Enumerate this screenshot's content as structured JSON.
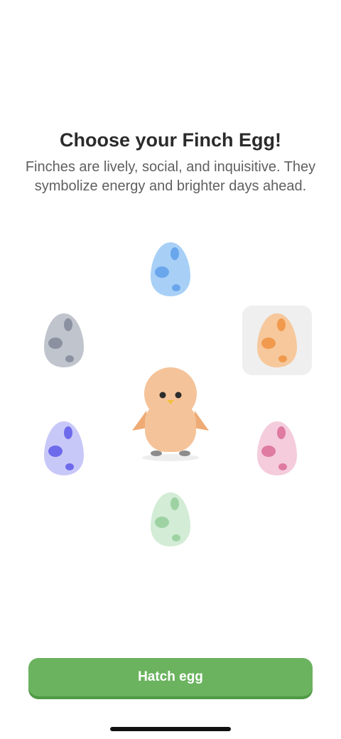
{
  "header": {
    "title": "Choose your Finch Egg!",
    "subtitle": "Finches are lively, social, and inquisitive. They symbolize energy and brighter days ahead."
  },
  "eggs": [
    {
      "name": "blue-egg",
      "color": "#a8d0f7",
      "spot": "#6aa6ec",
      "selected": false
    },
    {
      "name": "gray-egg",
      "color": "#c0c4cd",
      "spot": "#8b91a0",
      "selected": false
    },
    {
      "name": "orange-egg",
      "color": "#f6c89c",
      "spot": "#f19a4e",
      "selected": true
    },
    {
      "name": "purple-egg",
      "color": "#c8c8f8",
      "spot": "#6e6aec",
      "selected": false
    },
    {
      "name": "pink-egg",
      "color": "#f4ccdc",
      "spot": "#df7aa0",
      "selected": false
    },
    {
      "name": "green-egg",
      "color": "#d3ecd6",
      "spot": "#9ed2a3",
      "selected": false
    }
  ],
  "finch": {
    "body_color": "#f5c39a",
    "wing_color": "#efab74"
  },
  "actions": {
    "hatch_label": "Hatch egg"
  },
  "colors": {
    "accent": "#6bb35f",
    "accent_dark": "#4f9a45"
  }
}
